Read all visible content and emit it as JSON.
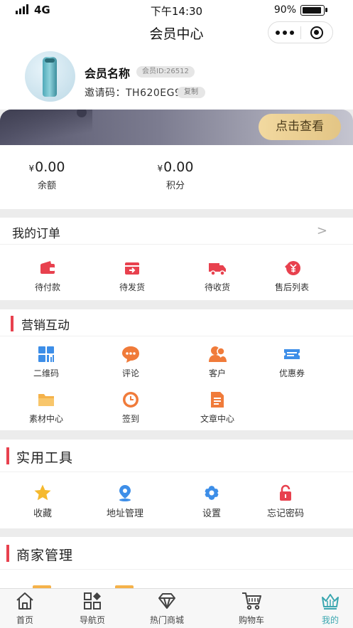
{
  "status_bar": {
    "network": "4G",
    "time": "下午14:30",
    "battery": "90%",
    "battery_level": 0.9
  },
  "nav": {
    "title": "会员中心"
  },
  "profile": {
    "name": "会员名称",
    "member_id": "会员ID:26512",
    "invite_code": "邀请码：TH620EG9",
    "copy_label": "复制"
  },
  "banner": {
    "button_label": "点击查看"
  },
  "balance": {
    "items": [
      {
        "currency": "¥",
        "value": "0.00",
        "label": "余额"
      },
      {
        "currency": "¥",
        "value": "0.00",
        "label": "积分"
      }
    ]
  },
  "orders": {
    "title": "我的订单",
    "chevron": ">",
    "items": [
      {
        "label": "待付款",
        "icon": "wallet-icon"
      },
      {
        "label": "待发货",
        "icon": "box-icon"
      },
      {
        "label": "待收货",
        "icon": "truck-icon"
      },
      {
        "label": "售后列表",
        "icon": "refund-icon"
      }
    ]
  },
  "marketing": {
    "title": "营销互动",
    "items": [
      {
        "label": "二维码",
        "icon": "qrcode-icon"
      },
      {
        "label": "评论",
        "icon": "comment-icon"
      },
      {
        "label": "客户",
        "icon": "customer-icon"
      },
      {
        "label": "优惠券",
        "icon": "coupon-icon"
      },
      {
        "label": "素材中心",
        "icon": "folder-icon"
      },
      {
        "label": "签到",
        "icon": "clock-icon"
      },
      {
        "label": "文章中心",
        "icon": "article-icon"
      }
    ]
  },
  "tools": {
    "title": "实用工具",
    "items": [
      {
        "label": "收藏",
        "icon": "star-icon"
      },
      {
        "label": "地址管理",
        "icon": "location-icon"
      },
      {
        "label": "设置",
        "icon": "gear-icon"
      },
      {
        "label": "忘记密码",
        "icon": "lock-icon"
      }
    ]
  },
  "merchant": {
    "title": "商家管理"
  },
  "tabbar": {
    "items": [
      {
        "label": "首页",
        "icon": "home-icon"
      },
      {
        "label": "导航页",
        "icon": "grid-icon"
      },
      {
        "label": "热门商城",
        "icon": "diamond-icon"
      },
      {
        "label": "购物车",
        "icon": "cart-icon"
      },
      {
        "label": "我的",
        "icon": "crown-icon",
        "active": true
      }
    ]
  },
  "colors": {
    "accent_red": "#e8414e",
    "gold_button": "#e9cd8f",
    "active_tab": "#3ba7b0",
    "blue_icon": "#3d8ee8",
    "orange_icon": "#f07b3a"
  }
}
